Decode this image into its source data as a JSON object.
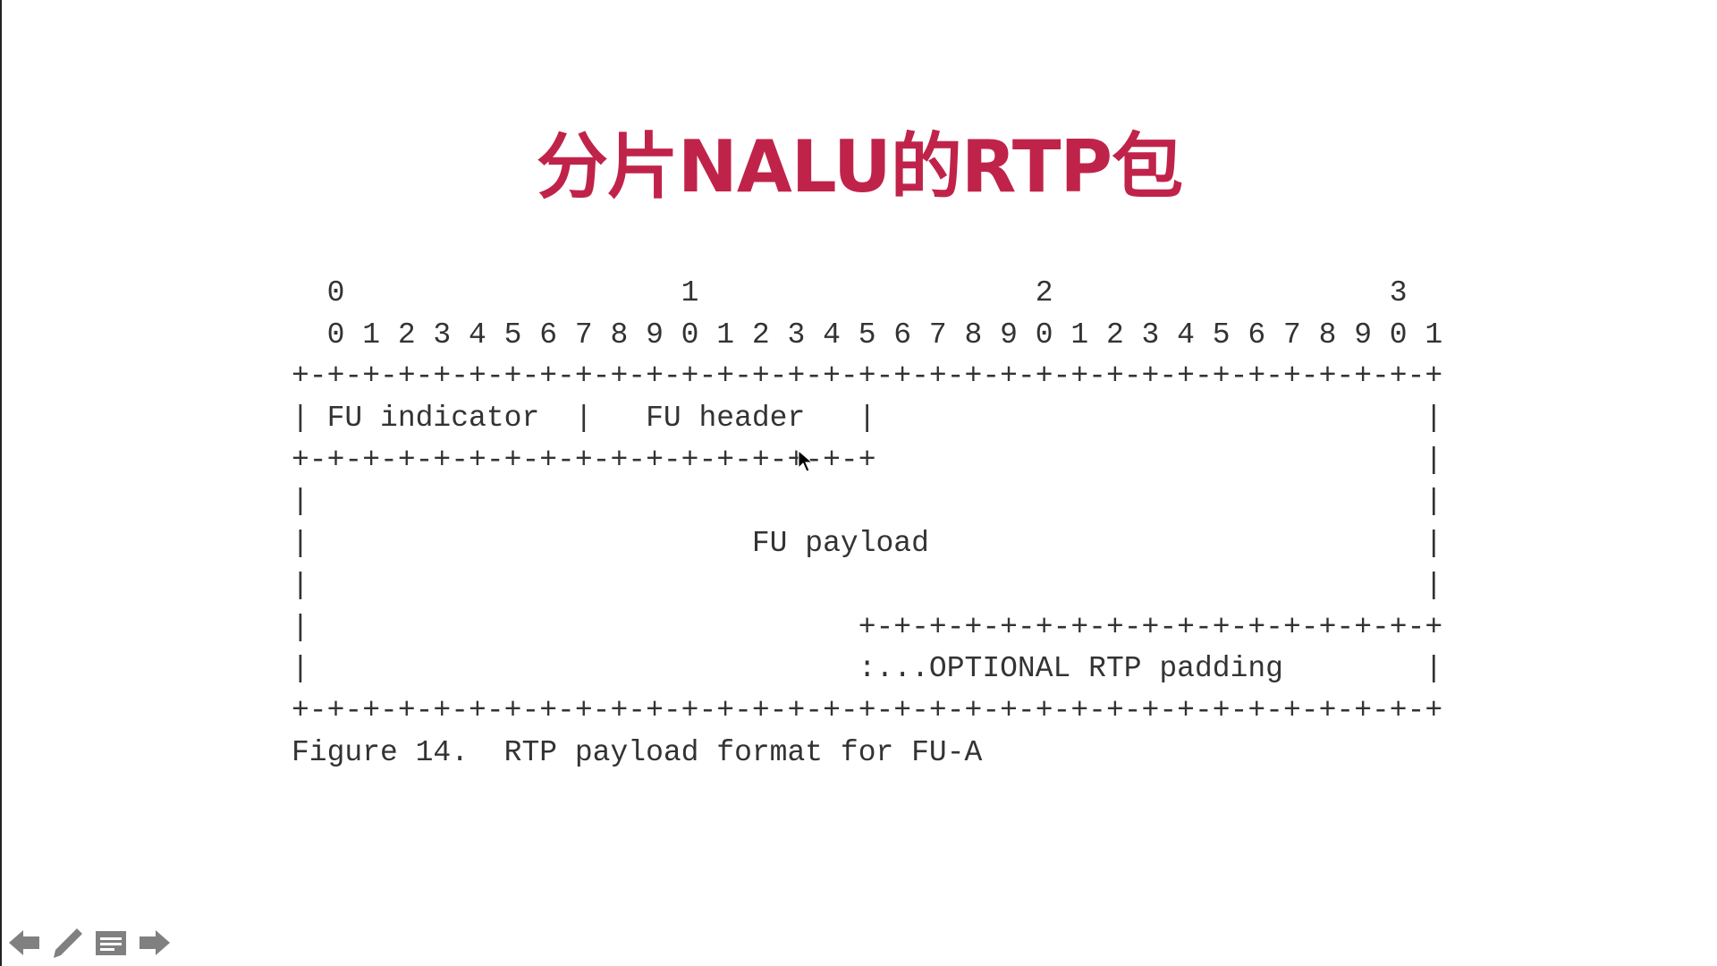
{
  "colors": {
    "accent": "#c0234a",
    "text": "#333333",
    "icon": "#808080"
  },
  "slide": {
    "title": "分片NALU的RTP包",
    "figure_lines": [
      "  0                   1                   2                   3",
      "  0 1 2 3 4 5 6 7 8 9 0 1 2 3 4 5 6 7 8 9 0 1 2 3 4 5 6 7 8 9 0 1",
      "+-+-+-+-+-+-+-+-+-+-+-+-+-+-+-+-+-+-+-+-+-+-+-+-+-+-+-+-+-+-+-+-+",
      "| FU indicator  |   FU header   |                               |",
      "+-+-+-+-+-+-+-+-+-+-+-+-+-+-+-+-+                               |",
      "|                                                               |",
      "|                         FU payload                            |",
      "|                                                               |",
      "|                               +-+-+-+-+-+-+-+-+-+-+-+-+-+-+-+-+",
      "|                               :...OPTIONAL RTP padding        |",
      "+-+-+-+-+-+-+-+-+-+-+-+-+-+-+-+-+-+-+-+-+-+-+-+-+-+-+-+-+-+-+-+-+",
      "Figure 14.  RTP payload format for FU-A"
    ]
  },
  "nav": {
    "icons": [
      "arrow-left-icon",
      "pencil-icon",
      "menu-icon",
      "arrow-right-icon"
    ]
  }
}
